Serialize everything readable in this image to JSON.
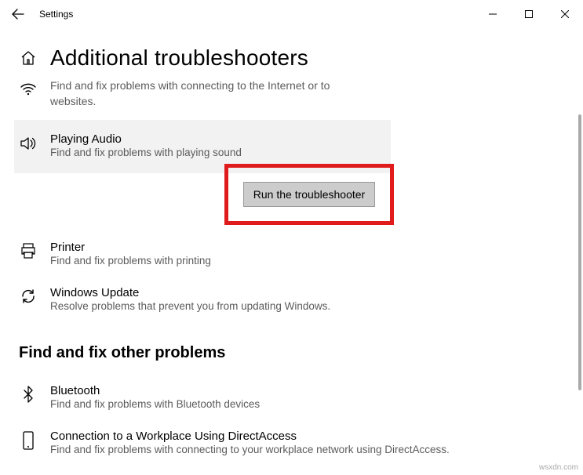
{
  "window": {
    "title": "Settings"
  },
  "page": {
    "title": "Additional troubleshooters",
    "subtitle": "Find and fix problems with connecting to the Internet or to websites."
  },
  "troubleshooters": {
    "playing_audio": {
      "title": "Playing Audio",
      "desc": "Find and fix problems with playing sound",
      "run_label": "Run the troubleshooter"
    },
    "printer": {
      "title": "Printer",
      "desc": "Find and fix problems with printing"
    },
    "windows_update": {
      "title": "Windows Update",
      "desc": "Resolve problems that prevent you from updating Windows."
    }
  },
  "section": {
    "other_problems": "Find and fix other problems"
  },
  "other": {
    "bluetooth": {
      "title": "Bluetooth",
      "desc": "Find and fix problems with Bluetooth devices"
    },
    "directaccess": {
      "title": "Connection to a Workplace Using DirectAccess",
      "desc": "Find and fix problems with connecting to your workplace network using DirectAccess."
    }
  },
  "watermark": "wsxdn.com"
}
